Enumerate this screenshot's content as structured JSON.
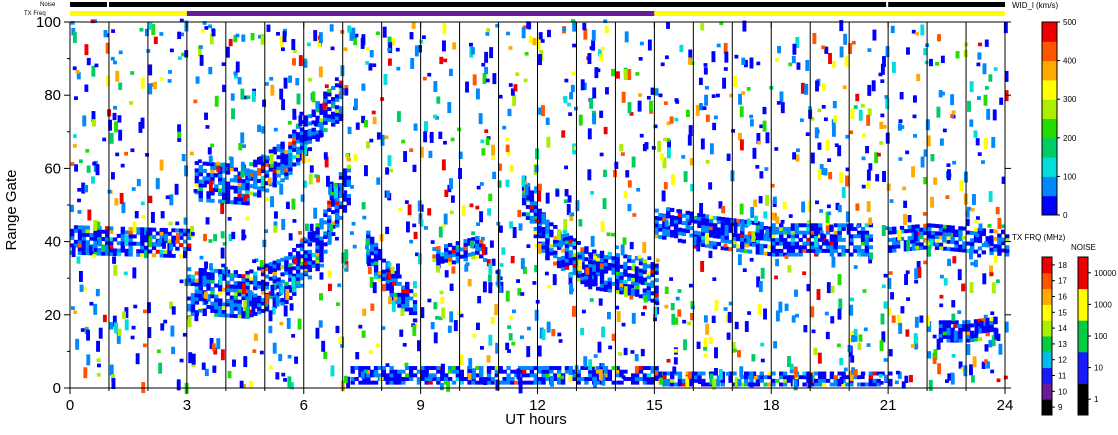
{
  "chart_data": {
    "type": "heatmap",
    "xlabel": "UT hours",
    "ylabel": "Range Gate",
    "xlim": [
      0,
      24
    ],
    "ylim": [
      0,
      100
    ],
    "x_ticks": [
      "0",
      "3",
      "6",
      "9",
      "12",
      "15",
      "18",
      "21",
      "24"
    ],
    "y_ticks": [
      "0",
      "20",
      "40",
      "60",
      "80",
      "100"
    ],
    "top_bar_labels": {
      "noise": "Noise",
      "txfreq": "TX Freq"
    },
    "noise_bar": {
      "color": "#000000",
      "gaps_hours": [
        0.95,
        20.95
      ]
    },
    "txfreq_bar": [
      {
        "start": 0,
        "end": 3,
        "color": "#ffff00"
      },
      {
        "start": 3,
        "end": 15,
        "color": "#6a1b9a"
      },
      {
        "start": 15,
        "end": 24,
        "color": "#ffff00"
      }
    ],
    "scan_lines_hours": [
      1,
      2,
      3,
      4,
      5,
      6,
      7,
      8,
      9,
      10,
      11,
      12,
      13,
      14,
      15,
      16,
      17,
      18,
      19,
      20,
      21,
      22,
      23
    ],
    "features": [
      {
        "name": "band",
        "points": [
          [
            0,
            40
          ],
          [
            3,
            39
          ]
        ],
        "width": 7
      },
      {
        "name": "band",
        "points": [
          [
            3,
            26
          ],
          [
            4.5,
            25
          ],
          [
            5.5,
            29
          ],
          [
            6.3,
            38
          ],
          [
            6.8,
            50
          ],
          [
            7.1,
            56
          ]
        ],
        "width": 12
      },
      {
        "name": "band",
        "points": [
          [
            3.2,
            56
          ],
          [
            4.5,
            55
          ],
          [
            5.5,
            62
          ],
          [
            6.5,
            75
          ],
          [
            6.9,
            78
          ]
        ],
        "width": 10
      },
      {
        "name": "band",
        "points": [
          [
            7.6,
            38
          ],
          [
            8.2,
            28
          ],
          [
            8.8,
            22
          ]
        ],
        "width": 8
      },
      {
        "name": "band",
        "points": [
          [
            9.3,
            35
          ],
          [
            10.4,
            38
          ],
          [
            10.6,
            36
          ]
        ],
        "width": 5
      },
      {
        "name": "band",
        "points": [
          [
            11.6,
            52
          ],
          [
            12.2,
            40
          ],
          [
            13.3,
            32
          ],
          [
            14.5,
            30
          ],
          [
            15,
            28
          ]
        ],
        "width": 10
      },
      {
        "name": "band",
        "points": [
          [
            15,
            45
          ],
          [
            16.5,
            42
          ],
          [
            18,
            40
          ],
          [
            20.5,
            40
          ]
        ],
        "width": 8
      },
      {
        "name": "band",
        "points": [
          [
            21,
            40
          ],
          [
            22,
            41
          ],
          [
            24,
            39
          ]
        ],
        "width": 6
      },
      {
        "name": "band",
        "points": [
          [
            22.3,
            15
          ],
          [
            23,
            15
          ],
          [
            23.7,
            16
          ]
        ],
        "width": 5
      },
      {
        "name": "band",
        "points": [
          [
            7.2,
            3
          ],
          [
            15,
            3
          ]
        ],
        "width": 4
      },
      {
        "name": "band",
        "points": [
          [
            15,
            2
          ],
          [
            21,
            2
          ]
        ],
        "width": 3
      }
    ],
    "colorbars": [
      {
        "title": "WID_l  (km/s)",
        "ticks": [
          "0",
          "100",
          "200",
          "300",
          "400",
          "500"
        ],
        "continuous": true,
        "colors": [
          "#0000ff",
          "#0088ff",
          "#00dddd",
          "#00cc66",
          "#22dd00",
          "#aaee00",
          "#ffff00",
          "#ffaa00",
          "#ff5500",
          "#ee0000"
        ]
      },
      {
        "title": "TX FRQ (MHz)",
        "ticks": [
          "9",
          "10",
          "11",
          "12",
          "13",
          "14",
          "15",
          "16",
          "17",
          "18"
        ],
        "colors": [
          "#000000",
          "#6a1b9a",
          "#1a1aff",
          "#00bbee",
          "#00cc44",
          "#aaee00",
          "#ffff00",
          "#ffaa00",
          "#ff5500",
          "#ee0000"
        ]
      },
      {
        "title": "NOISE",
        "ticks": [
          "1",
          "10",
          "100",
          "1000",
          "10000"
        ],
        "colors": [
          "#000000",
          "#1a1aff",
          "#00cc44",
          "#ffff00",
          "#ee0000"
        ]
      }
    ]
  }
}
